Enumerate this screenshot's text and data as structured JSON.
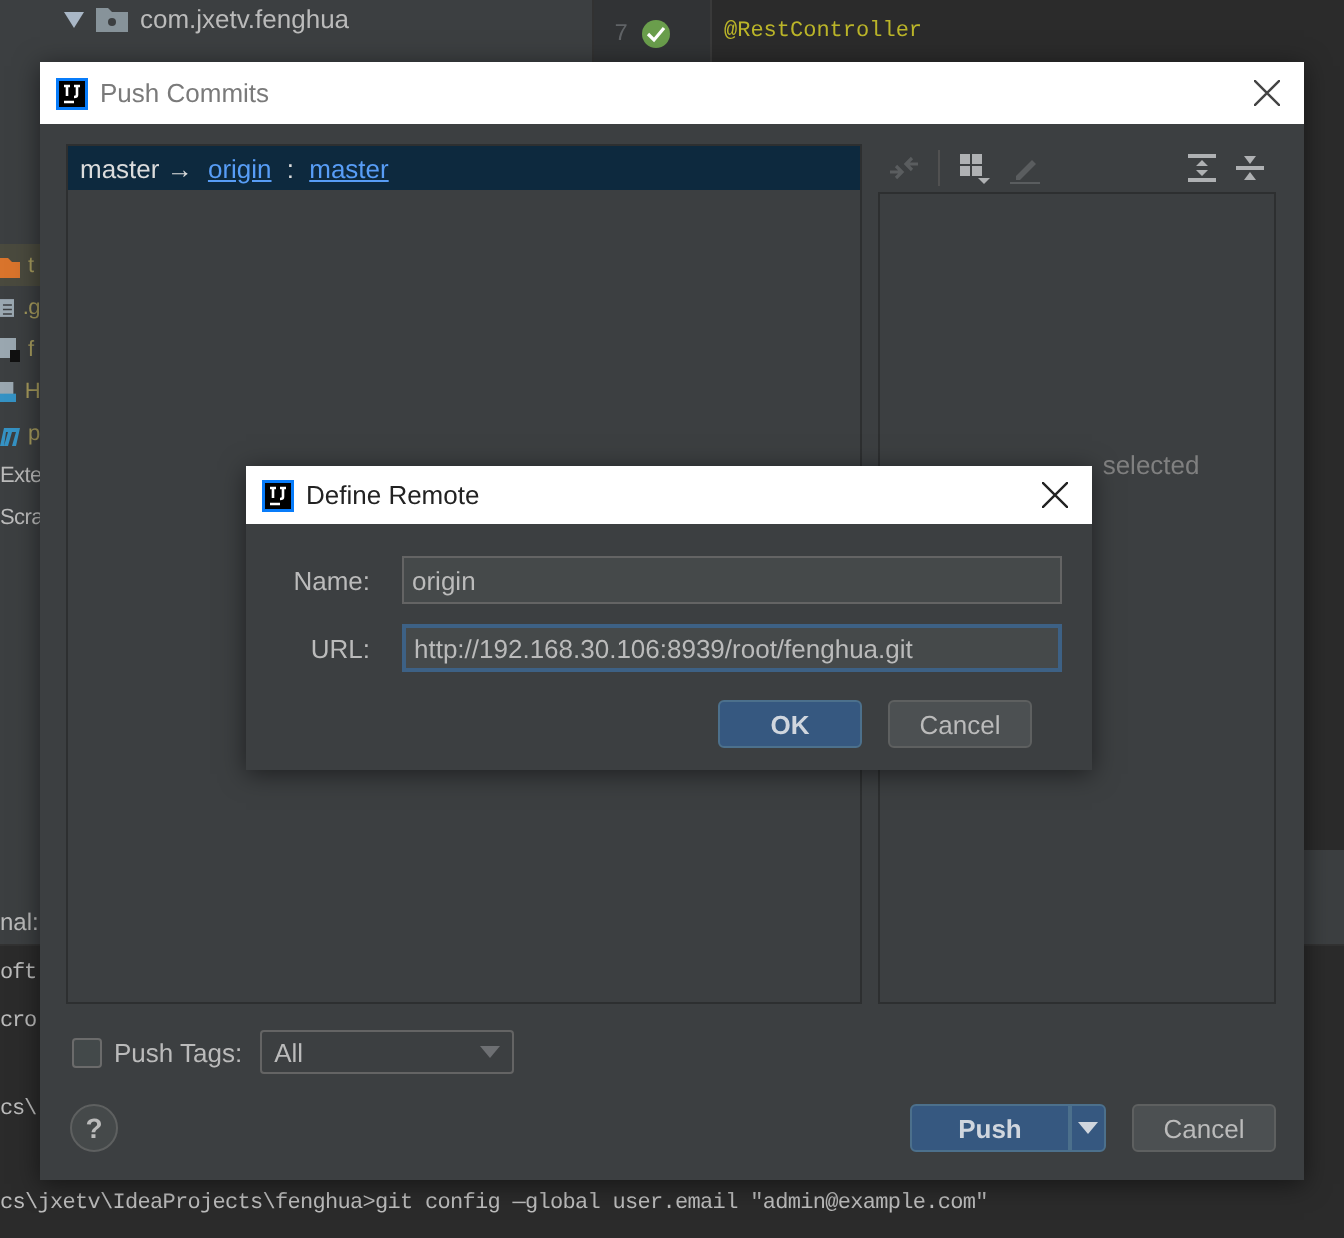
{
  "background_ide": {
    "project_tree": [
      {
        "label": "com.jxetv.fenghua",
        "expanded": true
      }
    ],
    "side_items": [
      {
        "kind": "folder",
        "label": "t",
        "selected": true
      },
      {
        "kind": "file",
        "label": ".g",
        "selected": false
      },
      {
        "kind": "script",
        "label": "f",
        "selected": false
      },
      {
        "kind": "html",
        "label": "H",
        "selected": false
      },
      {
        "kind": "maven",
        "label": "p",
        "selected": false
      },
      {
        "kind": "plain",
        "label": "Exte",
        "selected": false
      },
      {
        "kind": "plain",
        "label": "Scra",
        "selected": false
      }
    ],
    "line_number": "7",
    "editor_line": "@RestController",
    "terminal": {
      "tab": "nal:",
      "lines": [
        "oft",
        "cro",
        "cs\\"
      ],
      "command": "cs\\jxetv\\IdeaProjects\\fenghua>git config —global user.email \"admin@example.com\""
    }
  },
  "push_commits": {
    "title": "Push Commits",
    "branch_row": {
      "local": "master",
      "arrow": "→",
      "remote": "origin",
      "separator": ":",
      "remote_branch": "master",
      "selected": true
    },
    "toolbar": [
      {
        "kind": "compare",
        "disabled": true
      },
      {
        "kind": "group",
        "disabled": false
      },
      {
        "kind": "edit",
        "disabled": true
      },
      {
        "kind": "expand",
        "disabled": false
      },
      {
        "kind": "collapse",
        "disabled": false
      }
    ],
    "details_text": "selected",
    "push_tags": {
      "label": "Push Tags:",
      "checked": false,
      "value": "All"
    },
    "help": "?",
    "buttons": [
      {
        "label": "Push",
        "kind": "primary"
      },
      {
        "label": "Cancel",
        "kind": "secondary"
      }
    ]
  },
  "define_remote": {
    "title": "Define Remote",
    "fields": [
      {
        "label": "Name:",
        "value": "origin",
        "focused": false
      },
      {
        "label": "URL:",
        "value": "http://192.168.30.106:8939/root/fenghua.git",
        "focused": true
      }
    ],
    "buttons": [
      {
        "label": "OK",
        "kind": "primary"
      },
      {
        "label": "Cancel",
        "kind": "secondary"
      }
    ]
  }
}
